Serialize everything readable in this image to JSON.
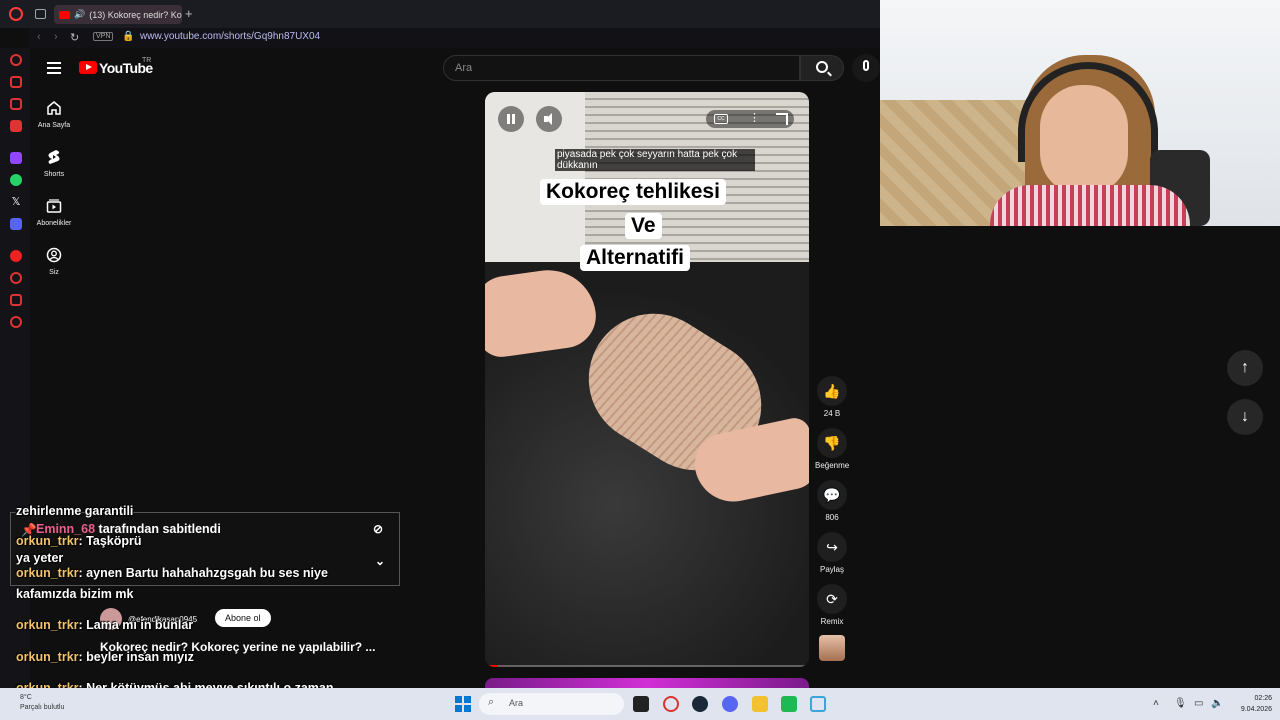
{
  "browser": {
    "tab_title": "(13) Kokoreç nedir? Ko",
    "url": "www.youtube.com/shorts/Gq9hn87UX04",
    "vpn_label": "VPN"
  },
  "youtube": {
    "logo_text": "YouTube",
    "region": "TR",
    "search_placeholder": "Ara",
    "guide": [
      {
        "label": "Ana Sayfa"
      },
      {
        "label": "Shorts"
      },
      {
        "label": "Abonelikler"
      },
      {
        "label": "Siz"
      }
    ]
  },
  "short": {
    "subtitle": "piyasada pek çok seyyarın hatta pek çok dükkanın",
    "title_lines": [
      "Kokoreç tehlikesi",
      "Ve",
      "Alternatifi"
    ],
    "cc_label": "CC",
    "progress": 0.04,
    "actions": {
      "like_count": "24 B",
      "dislike_label": "Beğenme",
      "comment_count": "806",
      "share_label": "Paylaş",
      "remix_label": "Remix"
    }
  },
  "chat": {
    "lines": [
      {
        "user": "",
        "text": "zehirlenme garantili"
      },
      {
        "user": "orkun_trkr",
        "text": ": Taşköprü"
      },
      {
        "user": "",
        "text": "ya yeter"
      },
      {
        "user": "orkun_trkr",
        "text": ": aynen Bartu hahahahzgsgah bu ses niye"
      },
      {
        "user": "",
        "text": "kafamızda bizim mk"
      },
      {
        "user": "orkun_trkr",
        "text": ": Lama mı in bunlar"
      },
      {
        "user": "orkun_trkr",
        "text": ": beyler insan mıyız"
      },
      {
        "user": "orkun_trkr",
        "text": ": Ner kötüymüş abi meyve sıkıntılı o zaman"
      }
    ],
    "pinned_user": "Eminn_68",
    "pinned_text": "tarafından sabitlendi",
    "channel": "@efendikasap0945",
    "subscribe_label": "Abone ol",
    "video_title": "Kokoreç nedir? Kokoreç yerine ne yapılabilir? ..."
  },
  "taskbar": {
    "search_placeholder": "Ara",
    "weather_temp": "8°C",
    "weather_text": "Parçalı bulutlu",
    "time": "02:26",
    "date": "9.04.2026"
  },
  "colors": {
    "accent_red": "#ff0000",
    "chat_username": "#f2c36b",
    "pinned_username": "#e85f8a"
  }
}
